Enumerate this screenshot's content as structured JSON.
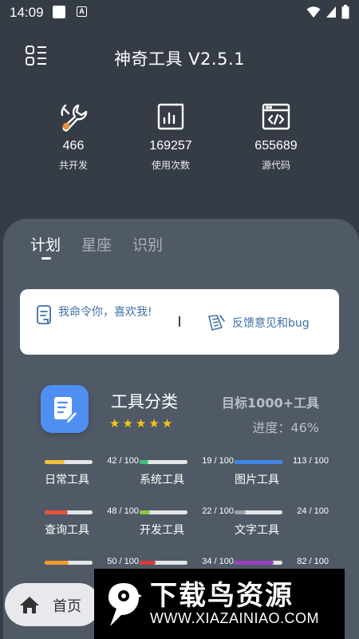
{
  "status_bar": {
    "time": "14:09",
    "icons": [
      "square-icon",
      "a-icon",
      "wifi-icon",
      "signal-icon",
      "battery-icon"
    ]
  },
  "header": {
    "title": "神奇工具 V2.5.1",
    "menu_icon": "grid-menu-icon"
  },
  "stats": [
    {
      "icon": "wrench-icon",
      "value": "466",
      "label": "共开发"
    },
    {
      "icon": "chart-icon",
      "value": "169257",
      "label": "使用次数"
    },
    {
      "icon": "code-icon",
      "value": "655689",
      "label": "源代码"
    }
  ],
  "tabs": [
    {
      "label": "计划",
      "active": true
    },
    {
      "label": "星座",
      "active": false
    },
    {
      "label": "识别",
      "active": false
    }
  ],
  "notice": {
    "left_text": "我命令你，喜欢我!",
    "right_text": "反馈意见和bug"
  },
  "category": {
    "title": "工具分类",
    "rating": 5,
    "goal": "目标1000+工具",
    "progress": "进度：46%"
  },
  "category_items": [
    {
      "name": "日常工具",
      "count": "42 / 100",
      "fraction": 0.42,
      "color": "#f2c23a"
    },
    {
      "name": "系统工具",
      "count": "19 / 100",
      "fraction": 0.19,
      "color": "#3cc07a"
    },
    {
      "name": "图片工具",
      "count": "113 / 100",
      "fraction": 1.0,
      "color": "#3d86e6"
    },
    {
      "name": "查询工具",
      "count": "48 / 100",
      "fraction": 0.48,
      "color": "#e8503a"
    },
    {
      "name": "开发工具",
      "count": "22 / 100",
      "fraction": 0.22,
      "color": "#8cc63f"
    },
    {
      "name": "文字工具",
      "count": "24 / 100",
      "fraction": 0.24,
      "color": "#9aa0a6"
    },
    {
      "name": "",
      "count": "50 / 100",
      "fraction": 0.5,
      "color": "#f39a2b"
    },
    {
      "name": "",
      "count": "34 / 100",
      "fraction": 0.34,
      "color": "#d53a3a"
    },
    {
      "name": "",
      "count": "82 / 100",
      "fraction": 0.82,
      "color": "#9b3fc4"
    }
  ],
  "bottom_nav": {
    "home_label": "首页"
  },
  "watermark": {
    "title": "下载鸟资源",
    "url": "WWW.XIAZAINIAO.COM"
  }
}
